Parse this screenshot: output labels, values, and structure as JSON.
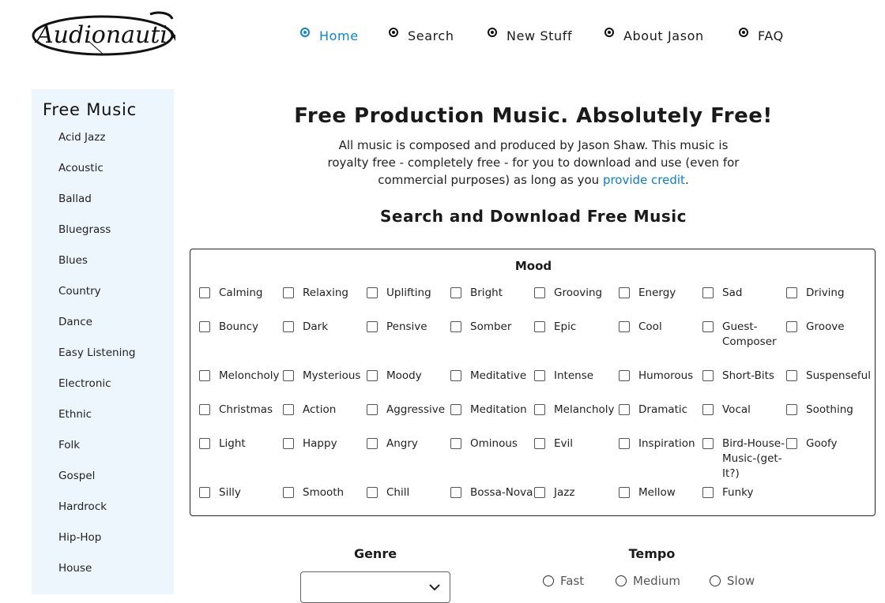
{
  "header": {
    "logo_text": "Audionautix",
    "nav": [
      {
        "label": "Home",
        "active": true
      },
      {
        "label": "Search",
        "active": false
      },
      {
        "label": "New Stuff",
        "active": false
      },
      {
        "label": "About Jason",
        "active": false
      },
      {
        "label": "FAQ",
        "active": false
      }
    ]
  },
  "sidebar": {
    "title": "Free Music",
    "items": [
      "Acid Jazz",
      "Acoustic",
      "Ballad",
      "Bluegrass",
      "Blues",
      "Country",
      "Dance",
      "Easy Listening",
      "Electronic",
      "Ethnic",
      "Folk",
      "Gospel",
      "Hardrock",
      "Hip-Hop",
      "House"
    ]
  },
  "main": {
    "title": "Free Production Music. Absolutely Free!",
    "intro_text": "All music is composed and produced by Jason Shaw. This music is royalty free - completely free - for you to download and use (even for commercial purposes) as long as you",
    "intro_link": "provide credit",
    "intro_end": ".",
    "search_title": "Search and Download Free Music"
  },
  "mood": {
    "title": "Mood",
    "rows": [
      [
        "Calming",
        "Relaxing",
        "Uplifting",
        "Bright",
        "Grooving",
        "Energy",
        "Sad",
        "Driving"
      ],
      [
        "Bouncy",
        "Dark",
        "Pensive",
        "Somber",
        "Epic",
        "Cool",
        "Guest-Composer",
        "Groove"
      ],
      [
        "Meloncholy",
        "Mysterious",
        "Moody",
        "Meditative",
        "Intense",
        "Humorous",
        "Short-Bits",
        "Suspenseful"
      ],
      [
        "Christmas",
        "Action",
        "Aggressive",
        "Meditation",
        "Melancholy",
        "Dramatic",
        "Vocal",
        "Soothing"
      ],
      [
        "Light",
        "Happy",
        "Angry",
        "Ominous",
        "Evil",
        "Inspiration",
        "Bird-House-Music-(get-It?)",
        "Goofy"
      ],
      [
        "Silly",
        "Smooth",
        "Chill",
        "Bossa-Nova",
        "Jazz",
        "Mellow",
        "Funky"
      ]
    ]
  },
  "genre": {
    "title": "Genre",
    "selected": ""
  },
  "tempo": {
    "title": "Tempo",
    "options": [
      "Fast",
      "Medium",
      "Slow"
    ]
  },
  "colors": {
    "accent": "#0a84d6",
    "sidebar_bg": "#eef6fd"
  },
  "icons": {
    "genre_select": "chevron-down-icon",
    "nav_bullet": "radio-bullet-icon"
  }
}
